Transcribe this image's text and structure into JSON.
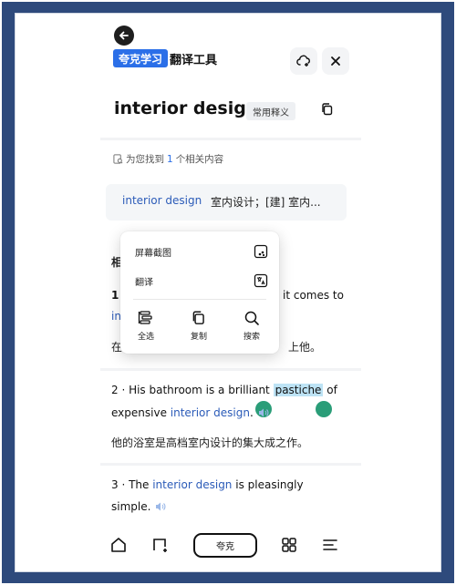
{
  "header": {
    "back_icon": "arrow-left-icon",
    "brand_badge": "夸克学习",
    "brand_tool": "翻译工具",
    "feedback_icon": "cloud-add-icon",
    "close_icon": "close-icon"
  },
  "entry": {
    "word": "interior design",
    "meaning_tag": "常用释义",
    "copy_icon": "copy-icon"
  },
  "results": {
    "found_prefix": "为您找到",
    "found_count": "1",
    "found_suffix": "个相关内容",
    "definition_term": "interior design",
    "definition_text": "室内设计；[建] 室内..."
  },
  "context_menu": {
    "screenshot_label": "屏幕截图",
    "translate_label": "翻译",
    "select_all_label": "全选",
    "copy_label": "复制",
    "search_label": "搜索"
  },
  "sentences": {
    "section_partial": "相",
    "s1_num": "1",
    "s1_tail": "it comes to",
    "s1_link_partial": "in",
    "s1_zh_start": "在",
    "s1_zh_end": "上他。",
    "s2_prefix": "2 · His bathroom is a brilliant ",
    "s2_selected": "pastiche",
    "s2_after": " of",
    "s2_line2_start": "expensive ",
    "s2_link": "interior design",
    "s2_end": ".",
    "s2_zh": "他的浴室是高档室内设计的集大成之作。",
    "s3_prefix": "3 · The ",
    "s3_link": "interior design",
    "s3_after": " is pleasingly",
    "s3_line2": "simple."
  },
  "bottom_nav": {
    "home_icon": "home-icon",
    "tabs_icon": "tabs-icon",
    "center_label": "夸克",
    "apps_icon": "grid-icon",
    "menu_icon": "menu-icon"
  },
  "colors": {
    "frame": "#2e4a7c",
    "accent": "#2b6fe8",
    "link": "#2b5bb8",
    "selection": "#bde3f5",
    "handle": "#2a9d78"
  }
}
